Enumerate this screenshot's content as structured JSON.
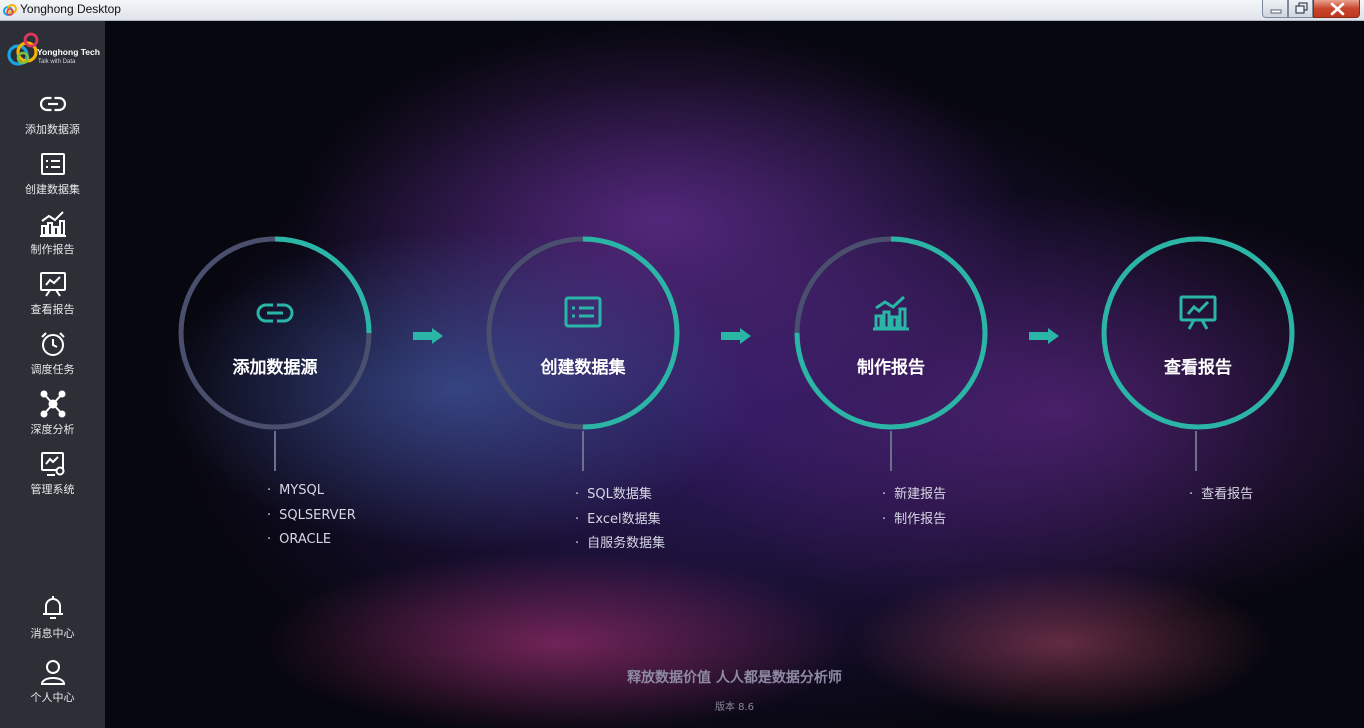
{
  "window": {
    "title": "Yonghong Desktop"
  },
  "logo": {
    "name": "Yonghong Tech",
    "slogan": "Talk with Data"
  },
  "sidebar": {
    "items": [
      {
        "label": "添加数据源",
        "icon": "link-icon"
      },
      {
        "label": "创建数据集",
        "icon": "dataset-icon"
      },
      {
        "label": "制作报告",
        "icon": "chart-icon"
      },
      {
        "label": "查看报告",
        "icon": "presentation-icon"
      },
      {
        "label": "调度任务",
        "icon": "alarm-clock-icon"
      },
      {
        "label": "深度分析",
        "icon": "network-icon"
      },
      {
        "label": "管理系统",
        "icon": "settings-monitor-icon"
      }
    ],
    "bottom_items": [
      {
        "label": "消息中心",
        "icon": "bell-icon"
      },
      {
        "label": "个人中心",
        "icon": "user-icon"
      }
    ]
  },
  "steps": [
    {
      "title": "添加数据源",
      "icon": "link-icon",
      "progress": 0.25,
      "items": [
        "MYSQL",
        "SQLSERVER",
        "ORACLE"
      ]
    },
    {
      "title": "创建数据集",
      "icon": "dataset-icon",
      "progress": 0.5,
      "items": [
        "SQL数据集",
        "Excel数据集",
        "自服务数据集"
      ]
    },
    {
      "title": "制作报告",
      "icon": "chart-icon",
      "progress": 0.75,
      "items": [
        "新建报告",
        "制作报告"
      ]
    },
    {
      "title": "查看报告",
      "icon": "presentation-icon",
      "progress": 1.0,
      "items": [
        "查看报告"
      ]
    }
  ],
  "footer": {
    "slogan": "释放数据价值 人人都是数据分析师",
    "version": "版本 8.6"
  },
  "colors": {
    "accent": "#2ab5a6",
    "ring_track": "#4b4f6e",
    "sidebar_bg": "#2c2f36"
  }
}
